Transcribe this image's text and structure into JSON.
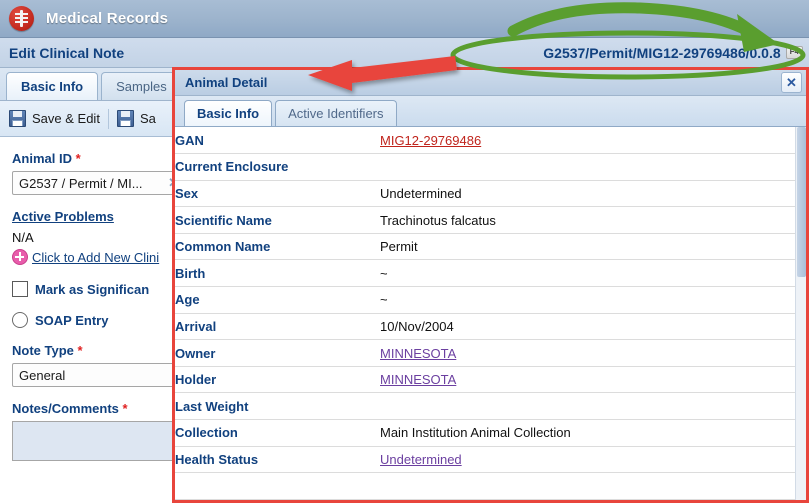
{
  "app": {
    "title": "Medical Records",
    "logo_icon": "caduceus-icon"
  },
  "page": {
    "title": "Edit Clinical Note",
    "breadcrumb": "G2537/Permit/MIG12-29769486/0.0.8",
    "breadcrumb_shortcut": "F4"
  },
  "background_tabs": [
    {
      "label": "Basic Info",
      "active": true
    },
    {
      "label": "Samples",
      "active": false
    }
  ],
  "toolbar": {
    "save_edit_label": "Save & Edit",
    "save_label": "Sa",
    "save_icon": "floppy-disk-icon"
  },
  "form": {
    "animal_id_label": "Animal ID",
    "animal_id_value": "G2537 / Permit / MI...",
    "animal_id_clear_icon": "clear-x-icon",
    "active_problems_label": "Active Problems",
    "active_problems_value": "N/A",
    "add_clinical_icon": "plus-circle-icon",
    "add_clinical_label": "Click to Add New Clini",
    "mark_significant_label": "Mark as Significan",
    "soap_entry_label": "SOAP Entry",
    "note_type_label": "Note Type",
    "note_type_value": "General",
    "notes_comments_label": "Notes/Comments",
    "required_marker": "*"
  },
  "dialog": {
    "title": "Animal Detail",
    "close_icon": "close-x-icon",
    "tabs": [
      {
        "label": "Basic Info",
        "active": true
      },
      {
        "label": "Active Identifiers",
        "active": false
      }
    ],
    "rows": [
      {
        "label": "GAN",
        "value": "MIG12-29769486",
        "style": "link-red"
      },
      {
        "label": "Current Enclosure",
        "value": "",
        "style": "plain"
      },
      {
        "label": "Sex",
        "value": "Undetermined",
        "style": "plain"
      },
      {
        "label": "Scientific Name",
        "value": "Trachinotus falcatus",
        "style": "plain"
      },
      {
        "label": "Common Name",
        "value": "Permit",
        "style": "plain"
      },
      {
        "label": "Birth",
        "value": "~",
        "style": "plain"
      },
      {
        "label": "Age",
        "value": "~",
        "style": "plain"
      },
      {
        "label": "Arrival",
        "value": "10/Nov/2004",
        "style": "plain"
      },
      {
        "label": "Owner",
        "value": "MINNESOTA",
        "style": "link-purple"
      },
      {
        "label": "Holder",
        "value": "MINNESOTA",
        "style": "link-purple"
      },
      {
        "label": "Last Weight",
        "value": "",
        "style": "plain"
      },
      {
        "label": "Collection",
        "value": "Main Institution Animal Collection",
        "style": "plain"
      },
      {
        "label": "Health Status",
        "value": "Undetermined",
        "style": "link-purple"
      },
      {
        "label": "",
        "value": "",
        "style": "plain"
      }
    ]
  },
  "annotations": {
    "green_color": "#5a9e2f",
    "red_color": "#e8453c",
    "green_arrow_name": "green-curved-arrow",
    "green_oval_name": "green-highlight-oval",
    "red_arrow_name": "red-pointer-arrow",
    "red_box_name": "red-highlight-box"
  }
}
